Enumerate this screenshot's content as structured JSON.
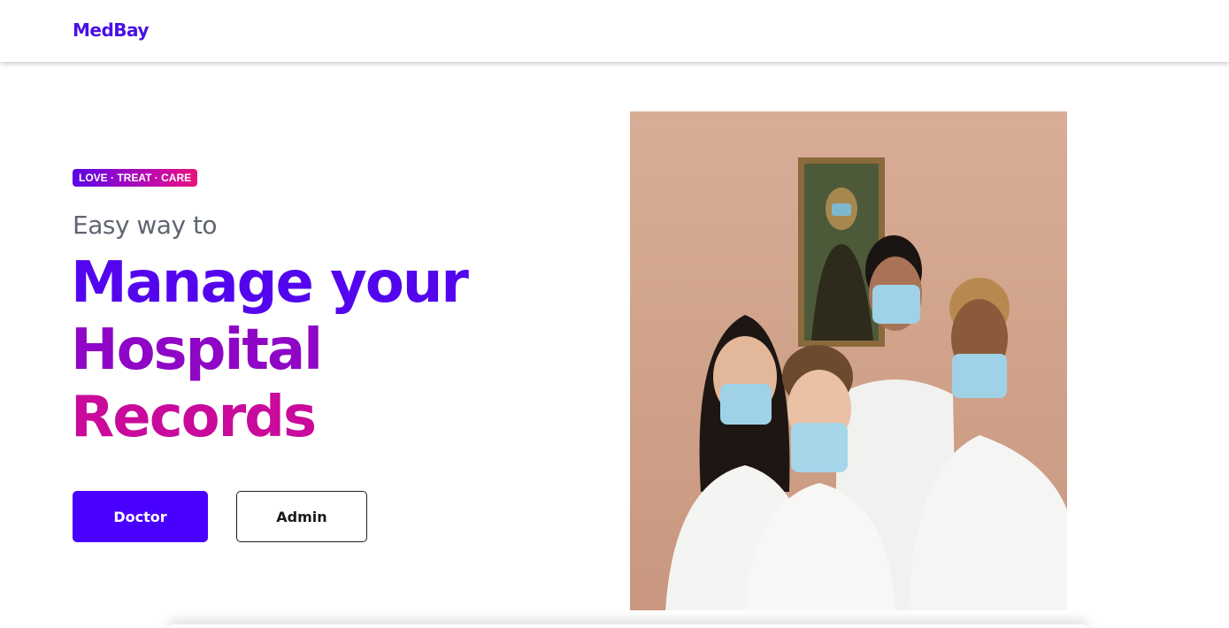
{
  "navbar": {
    "brand": "MedBay",
    "brand_color": "#4a0fe6"
  },
  "hero": {
    "tagline": "LOVE · TREAT · CARE",
    "subheading": "Easy way to",
    "headline_lines": [
      "Manage your",
      "Hospital",
      "Records"
    ],
    "headline_colors": [
      "#5306ee",
      "#8f06c6",
      "#c90a9b"
    ],
    "buttons": {
      "doctor": "Doctor",
      "admin": "Admin"
    },
    "accent_color": "#4a00ff"
  }
}
